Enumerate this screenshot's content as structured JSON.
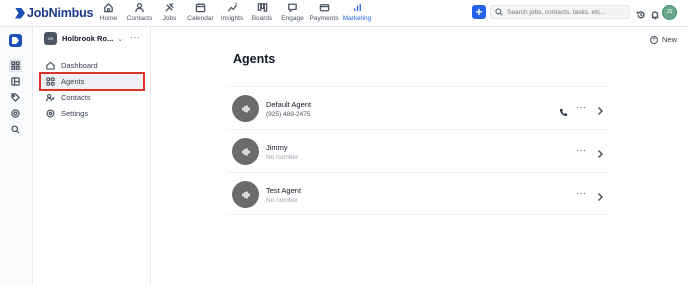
{
  "brand": {
    "name": "JobNimbus",
    "color": "#1e4fb6"
  },
  "nav": [
    {
      "label": "Home",
      "icon": "home-icon",
      "active": false
    },
    {
      "label": "Contacts",
      "icon": "contacts-icon",
      "active": false
    },
    {
      "label": "Jobs",
      "icon": "jobs-icon",
      "active": false
    },
    {
      "label": "Calendar",
      "icon": "calendar-icon",
      "active": false
    },
    {
      "label": "Insights",
      "icon": "insights-icon",
      "active": false
    },
    {
      "label": "Boards",
      "icon": "boards-icon",
      "active": false
    },
    {
      "label": "Engage",
      "icon": "engage-icon",
      "active": false
    },
    {
      "label": "Payments",
      "icon": "payments-icon",
      "active": false
    },
    {
      "label": "Marketing",
      "icon": "marketing-icon",
      "active": true
    }
  ],
  "search": {
    "placeholder": "Search jobs, contacts, tasks, etc..."
  },
  "user": {
    "initials": "JS"
  },
  "org": {
    "badge": "HR",
    "name": "Holbrook Ro...",
    "chevron": "⌄",
    "more": "···"
  },
  "sidebar": {
    "items": [
      {
        "label": "Dashboard",
        "icon": "dashboard-icon"
      },
      {
        "label": "Agents",
        "icon": "agents-icon",
        "active": true
      },
      {
        "label": "Contacts",
        "icon": "contacts-icon"
      },
      {
        "label": "Settings",
        "icon": "settings-icon"
      }
    ]
  },
  "main": {
    "new_label": "New",
    "title": "Agents",
    "agents": [
      {
        "name": "Default Agent",
        "sub": "(925) 489-2475",
        "has_phone": true
      },
      {
        "name": "Jimmy",
        "sub": "No number",
        "has_phone": false
      },
      {
        "name": "Test Agent",
        "sub": "No number",
        "has_phone": false
      }
    ],
    "more": "···"
  },
  "colors": {
    "accent": "#2563eb",
    "highlight_outline": "#d9342b"
  }
}
